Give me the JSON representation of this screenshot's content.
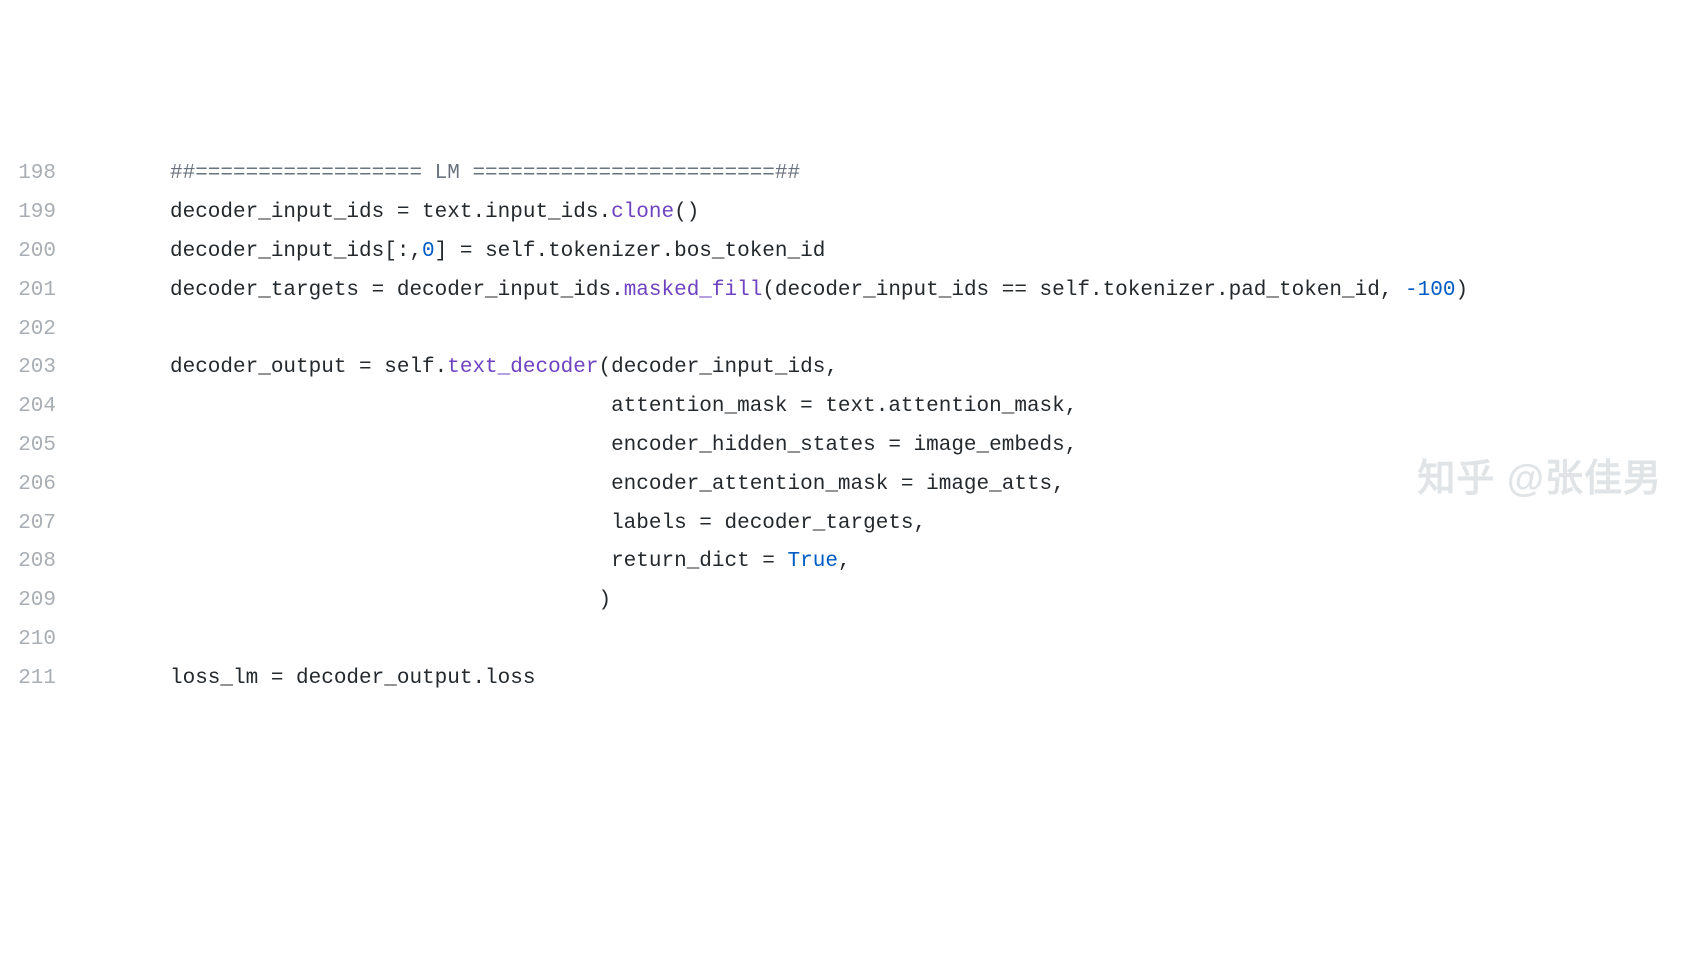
{
  "lines": [
    {
      "num": "198",
      "indent": "",
      "tokens": [
        {
          "cls": "comment",
          "text": "##================== LM ========================##"
        }
      ]
    },
    {
      "num": "199",
      "indent": "",
      "tokens": [
        {
          "cls": "",
          "text": "decoder_input_ids = text.input_ids."
        },
        {
          "cls": "function",
          "text": "clone"
        },
        {
          "cls": "",
          "text": "()"
        }
      ]
    },
    {
      "num": "200",
      "indent": "",
      "tokens": [
        {
          "cls": "",
          "text": "decoder_input_ids[:,"
        },
        {
          "cls": "number",
          "text": "0"
        },
        {
          "cls": "",
          "text": "] = self.tokenizer.bos_token_id"
        }
      ]
    },
    {
      "num": "201",
      "indent": "",
      "tokens": [
        {
          "cls": "",
          "text": "decoder_targets = decoder_input_ids."
        },
        {
          "cls": "function",
          "text": "masked_fill"
        },
        {
          "cls": "",
          "text": "(decoder_input_ids == self.tokenizer.pad_token_id, "
        },
        {
          "cls": "number",
          "text": "-100"
        },
        {
          "cls": "",
          "text": ")"
        }
      ]
    },
    {
      "num": "202",
      "indent": "",
      "tokens": []
    },
    {
      "num": "203",
      "indent": "",
      "tokens": [
        {
          "cls": "",
          "text": "decoder_output = self."
        },
        {
          "cls": "function",
          "text": "text_decoder"
        },
        {
          "cls": "",
          "text": "(decoder_input_ids,"
        }
      ]
    },
    {
      "num": "204",
      "indent": "                                   ",
      "tokens": [
        {
          "cls": "",
          "text": "attention_mask = text.attention_mask,"
        }
      ]
    },
    {
      "num": "205",
      "indent": "                                   ",
      "tokens": [
        {
          "cls": "",
          "text": "encoder_hidden_states = image_embeds,"
        }
      ]
    },
    {
      "num": "206",
      "indent": "                                   ",
      "tokens": [
        {
          "cls": "",
          "text": "encoder_attention_mask = image_atts,"
        }
      ]
    },
    {
      "num": "207",
      "indent": "                                   ",
      "tokens": [
        {
          "cls": "",
          "text": "labels = decoder_targets,"
        }
      ]
    },
    {
      "num": "208",
      "indent": "                                   ",
      "tokens": [
        {
          "cls": "",
          "text": "return_dict = "
        },
        {
          "cls": "constant",
          "text": "True"
        },
        {
          "cls": "",
          "text": ","
        }
      ]
    },
    {
      "num": "209",
      "indent": "                                  ",
      "tokens": [
        {
          "cls": "",
          "text": ")"
        }
      ]
    },
    {
      "num": "210",
      "indent": "",
      "tokens": []
    },
    {
      "num": "211",
      "indent": "",
      "tokens": [
        {
          "cls": "",
          "text": "loss_lm = decoder_output.loss"
        }
      ]
    }
  ],
  "watermark": "知乎 @张佳男"
}
